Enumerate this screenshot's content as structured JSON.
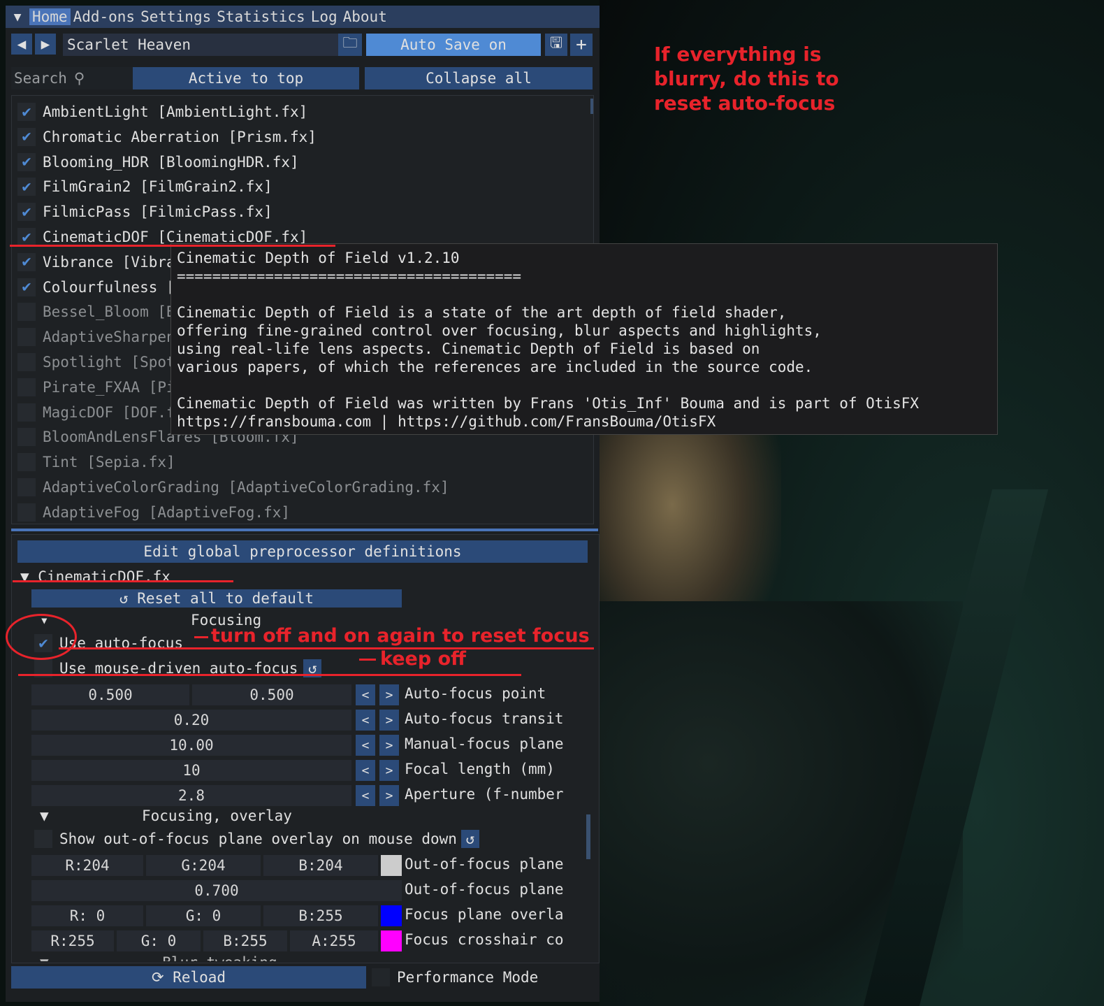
{
  "annotation": {
    "top_note": [
      "If everything is",
      "blurry, do this to",
      "reset auto-focus"
    ],
    "turn_off": "turn off and on again to reset focus",
    "keep_off": "keep off"
  },
  "menu": [
    "Home",
    "Add-ons",
    "Settings",
    "Statistics",
    "Log",
    "About"
  ],
  "toolbar": {
    "preset": "Scarlet Heaven",
    "auto_save": "Auto Save on",
    "search_placeholder": "Search",
    "active_to_top": "Active to top",
    "collapse_all": "Collapse all"
  },
  "effects": [
    {
      "label": "AmbientLight [AmbientLight.fx]",
      "enabled": true
    },
    {
      "label": "Chromatic Aberration [Prism.fx]",
      "enabled": true
    },
    {
      "label": "Blooming_HDR [BloomingHDR.fx]",
      "enabled": true
    },
    {
      "label": "FilmGrain2 [FilmGrain2.fx]",
      "enabled": true
    },
    {
      "label": "FilmicPass [FilmicPass.fx]",
      "enabled": true
    },
    {
      "label": "CinematicDOF [CinematicDOF.fx]",
      "enabled": true
    },
    {
      "label": "Vibrance [Vibrance.fx]",
      "enabled": true
    },
    {
      "label": "Colourfulness [Colourfulness.fx]",
      "enabled": true
    },
    {
      "label": "Bessel_Bloom [Bessel_Bloom.fx]",
      "enabled": false
    },
    {
      "label": "AdaptiveSharpen [AdaptiveSharpen.fx]",
      "enabled": false
    },
    {
      "label": "Spotlight [Spotlight.fx]",
      "enabled": false
    },
    {
      "label": "Pirate_FXAA [Pirate_FXAA.fx]",
      "enabled": false
    },
    {
      "label": "MagicDOF [DOF.fx]",
      "enabled": false
    },
    {
      "label": "BloomAndLensFlares [Bloom.fx]",
      "enabled": false
    },
    {
      "label": "Tint [Sepia.fx]",
      "enabled": false
    },
    {
      "label": "AdaptiveColorGrading [AdaptiveColorGrading.fx]",
      "enabled": false
    },
    {
      "label": "AdaptiveFog [AdaptiveFog.fx]",
      "enabled": false
    }
  ],
  "tooltip": {
    "title": "Cinematic Depth of Field v1.2.10",
    "rule": "=======================================",
    "lines": [
      "Cinematic Depth of Field is a state of the art depth of field shader,",
      "offering fine-grained control over focusing, blur aspects and highlights,",
      "using real-life lens aspects. Cinematic Depth of Field is based on",
      "various papers, of which the references are included in the source code.",
      "",
      "Cinematic Depth of Field was written by Frans 'Otis_Inf' Bouma and is part of OtisFX",
      "https://fransbouma.com | https://github.com/FransBouma/OtisFX"
    ]
  },
  "params": {
    "edit_global": "Edit global preprocessor definitions",
    "file": "CinematicDOF.fx",
    "reset_all": "Reset all to default",
    "section_focusing": "Focusing",
    "use_autofocus": "Use auto-focus",
    "use_mouse_autofocus": "Use mouse-driven auto-focus",
    "autofocus_point": {
      "x": "0.500",
      "y": "0.500",
      "label": "Auto-focus point"
    },
    "autofocus_transition": {
      "value": "0.20",
      "label": "Auto-focus transit"
    },
    "manual_focus_plane": {
      "value": "10.00",
      "label": "Manual-focus plane"
    },
    "focal_length": {
      "value": "10",
      "label": "Focal length (mm)"
    },
    "aperture": {
      "value": "2.8",
      "label": "Aperture (f-number"
    },
    "section_overlay": "Focusing, overlay",
    "show_overlay": "Show out-of-focus plane overlay on mouse down",
    "oof_color": {
      "r": "R:204",
      "g": "G:204",
      "b": "B:204",
      "label": "Out-of-focus plane",
      "swatch": "#cccccc"
    },
    "oof_opacity": {
      "value": "0.700",
      "label": "Out-of-focus plane"
    },
    "focus_plane_color": {
      "r": "R:  0",
      "g": "G:  0",
      "b": "B:255",
      "label": "Focus plane overla",
      "swatch": "#0000ff"
    },
    "crosshair_color": {
      "r": "R:255",
      "g": "G:  0",
      "b": "B:255",
      "a": "A:255",
      "label": "Focus crosshair co",
      "swatch": "#ff00ff"
    },
    "section_blur": "Blur tweaking"
  },
  "footer": {
    "reload": "Reload",
    "performance_mode": "Performance Mode"
  }
}
